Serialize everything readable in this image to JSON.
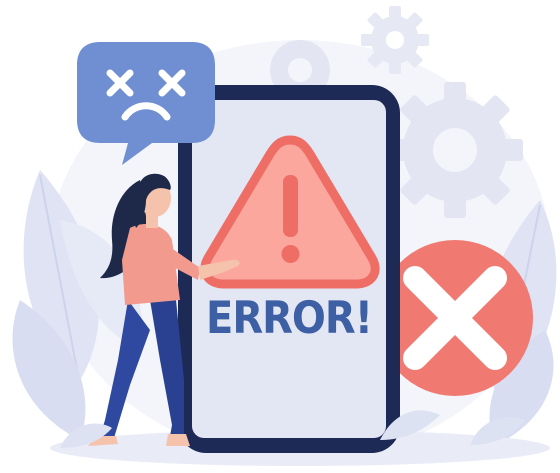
{
  "illustration": {
    "message": "ERROR!",
    "icons": {
      "speech_bubble": "sad-face-icon",
      "warning": "warning-triangle-icon",
      "close": "close-circle-icon",
      "gears": "gear-icon"
    },
    "colors": {
      "phone_frame": "#1e2a56",
      "phone_screen": "#e3e6f3",
      "error_text": "#3d5fa3",
      "warning_fill": "#fba79d",
      "warning_stroke": "#ee6e66",
      "close_circle": "#f07a72",
      "speech_bubble": "#6f8fd2",
      "leaves": "#dde2f3",
      "gears": "#e8ebf5",
      "person_shirt": "#f29a8e",
      "person_pants": "#2f48a0",
      "person_hair": "#1e2848",
      "skin": "#f5c2ac"
    }
  }
}
